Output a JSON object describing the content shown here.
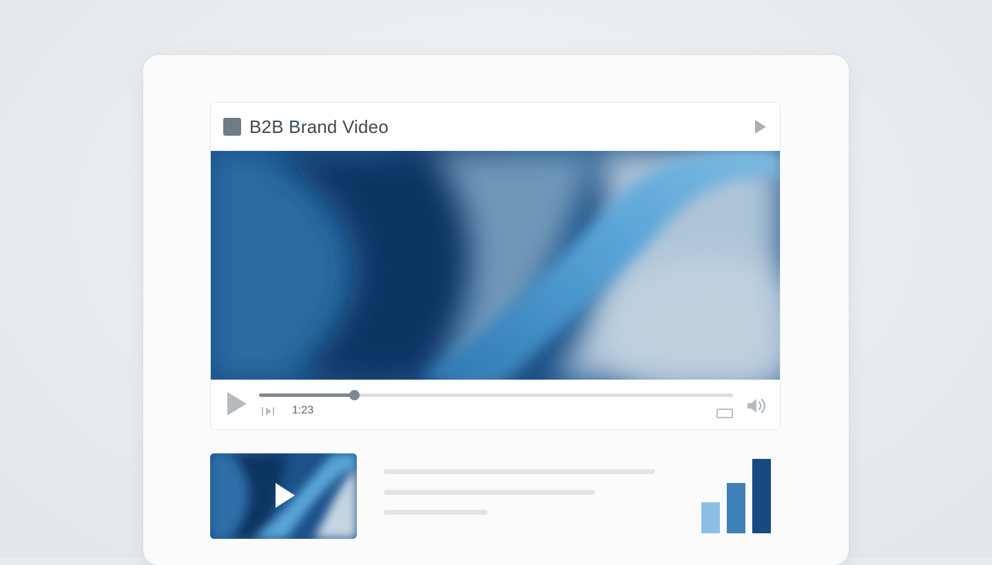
{
  "player": {
    "title": "B2B Brand Video",
    "current_time": "1:23",
    "progress_fraction": 0.2,
    "icons": {
      "title_icon": "square-icon",
      "header_action": "play-icon",
      "control_play": "play-icon",
      "skip": "skip-next-icon",
      "captions": "captions-icon",
      "volume": "volume-icon"
    }
  },
  "related": {
    "thumbnail_icon": "play-icon",
    "bars": [
      {
        "value": 0.42,
        "color": "#8dbfe6"
      },
      {
        "value": 0.68,
        "color": "#3f80b7"
      },
      {
        "value": 1.0,
        "color": "#174a82"
      }
    ]
  },
  "colors": {
    "accent_dark": "#12396b",
    "accent_mid": "#2f7ab4",
    "accent_light": "#8dbfe6",
    "progress": "#7d8890"
  }
}
